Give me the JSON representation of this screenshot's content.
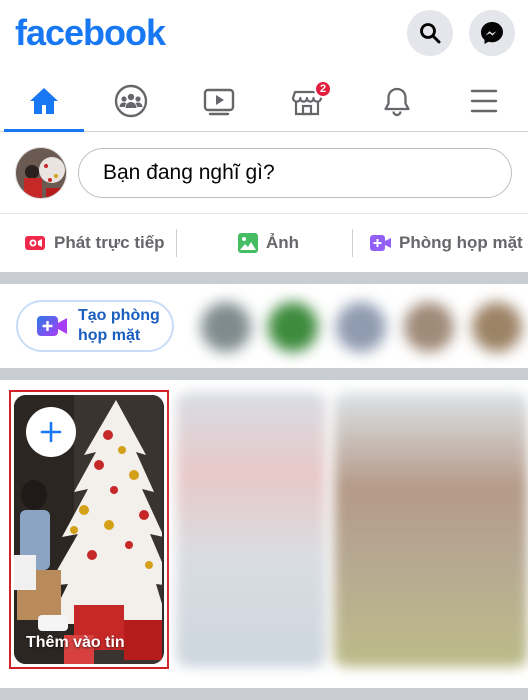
{
  "header": {
    "logo_text": "facebook",
    "brand_color": "#1877f2",
    "search_icon": "search-icon",
    "messenger_icon": "messenger-icon"
  },
  "tabs": [
    {
      "name": "home",
      "icon": "home-icon",
      "active": true
    },
    {
      "name": "groups",
      "icon": "groups-icon",
      "active": false
    },
    {
      "name": "watch",
      "icon": "video-icon",
      "active": false
    },
    {
      "name": "marketplace",
      "icon": "marketplace-icon",
      "active": false,
      "badge": "2"
    },
    {
      "name": "notifications",
      "icon": "bell-icon",
      "active": false
    },
    {
      "name": "menu",
      "icon": "hamburger-icon",
      "active": false
    }
  ],
  "composer": {
    "placeholder": "Bạn đang nghĩ gì?"
  },
  "actions": [
    {
      "label": "Phát trực tiếp",
      "icon": "live-video-icon",
      "color": "#f02849"
    },
    {
      "label": "Ảnh",
      "icon": "photo-icon",
      "color": "#45bd62"
    },
    {
      "label": "Phòng họp mặt",
      "icon": "room-icon",
      "color": "#9360f7"
    }
  ],
  "rooms": {
    "create_label": "Tạo phòng họp mặt"
  },
  "stories": {
    "create_label": "Thêm vào tin",
    "highlight_color": "#d32027"
  }
}
